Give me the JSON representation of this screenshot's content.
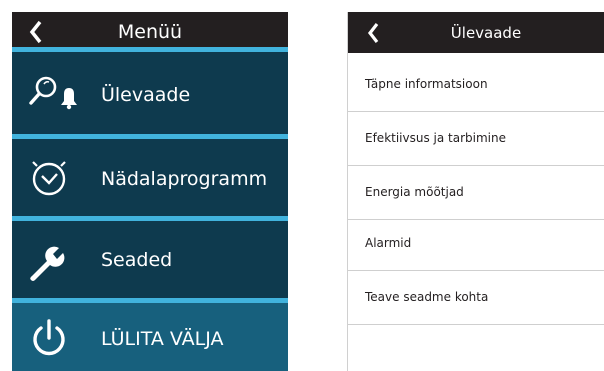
{
  "left": {
    "title": "Menüü",
    "items": [
      {
        "label": "Ülevaade",
        "icon": "search-bell-icon"
      },
      {
        "label": "Nädalaprogramm",
        "icon": "clock-icon"
      },
      {
        "label": "Seaded",
        "icon": "wrench-icon"
      },
      {
        "label": "LÜLITA VÄLJA",
        "icon": "power-icon"
      }
    ]
  },
  "right": {
    "title": "Ülevaade",
    "items": [
      {
        "label": "Täpne informatsioon"
      },
      {
        "label": "Efektiivsus ja tarbimine"
      },
      {
        "label": "Energia mõõtjad"
      },
      {
        "label": "Alarmid"
      },
      {
        "label": "Teave seadme kohta"
      }
    ]
  },
  "colors": {
    "header_bg": "#231f20",
    "menu_bg": "#0e3a4e",
    "power_bg": "#17607d",
    "accent": "#41b3dd"
  }
}
